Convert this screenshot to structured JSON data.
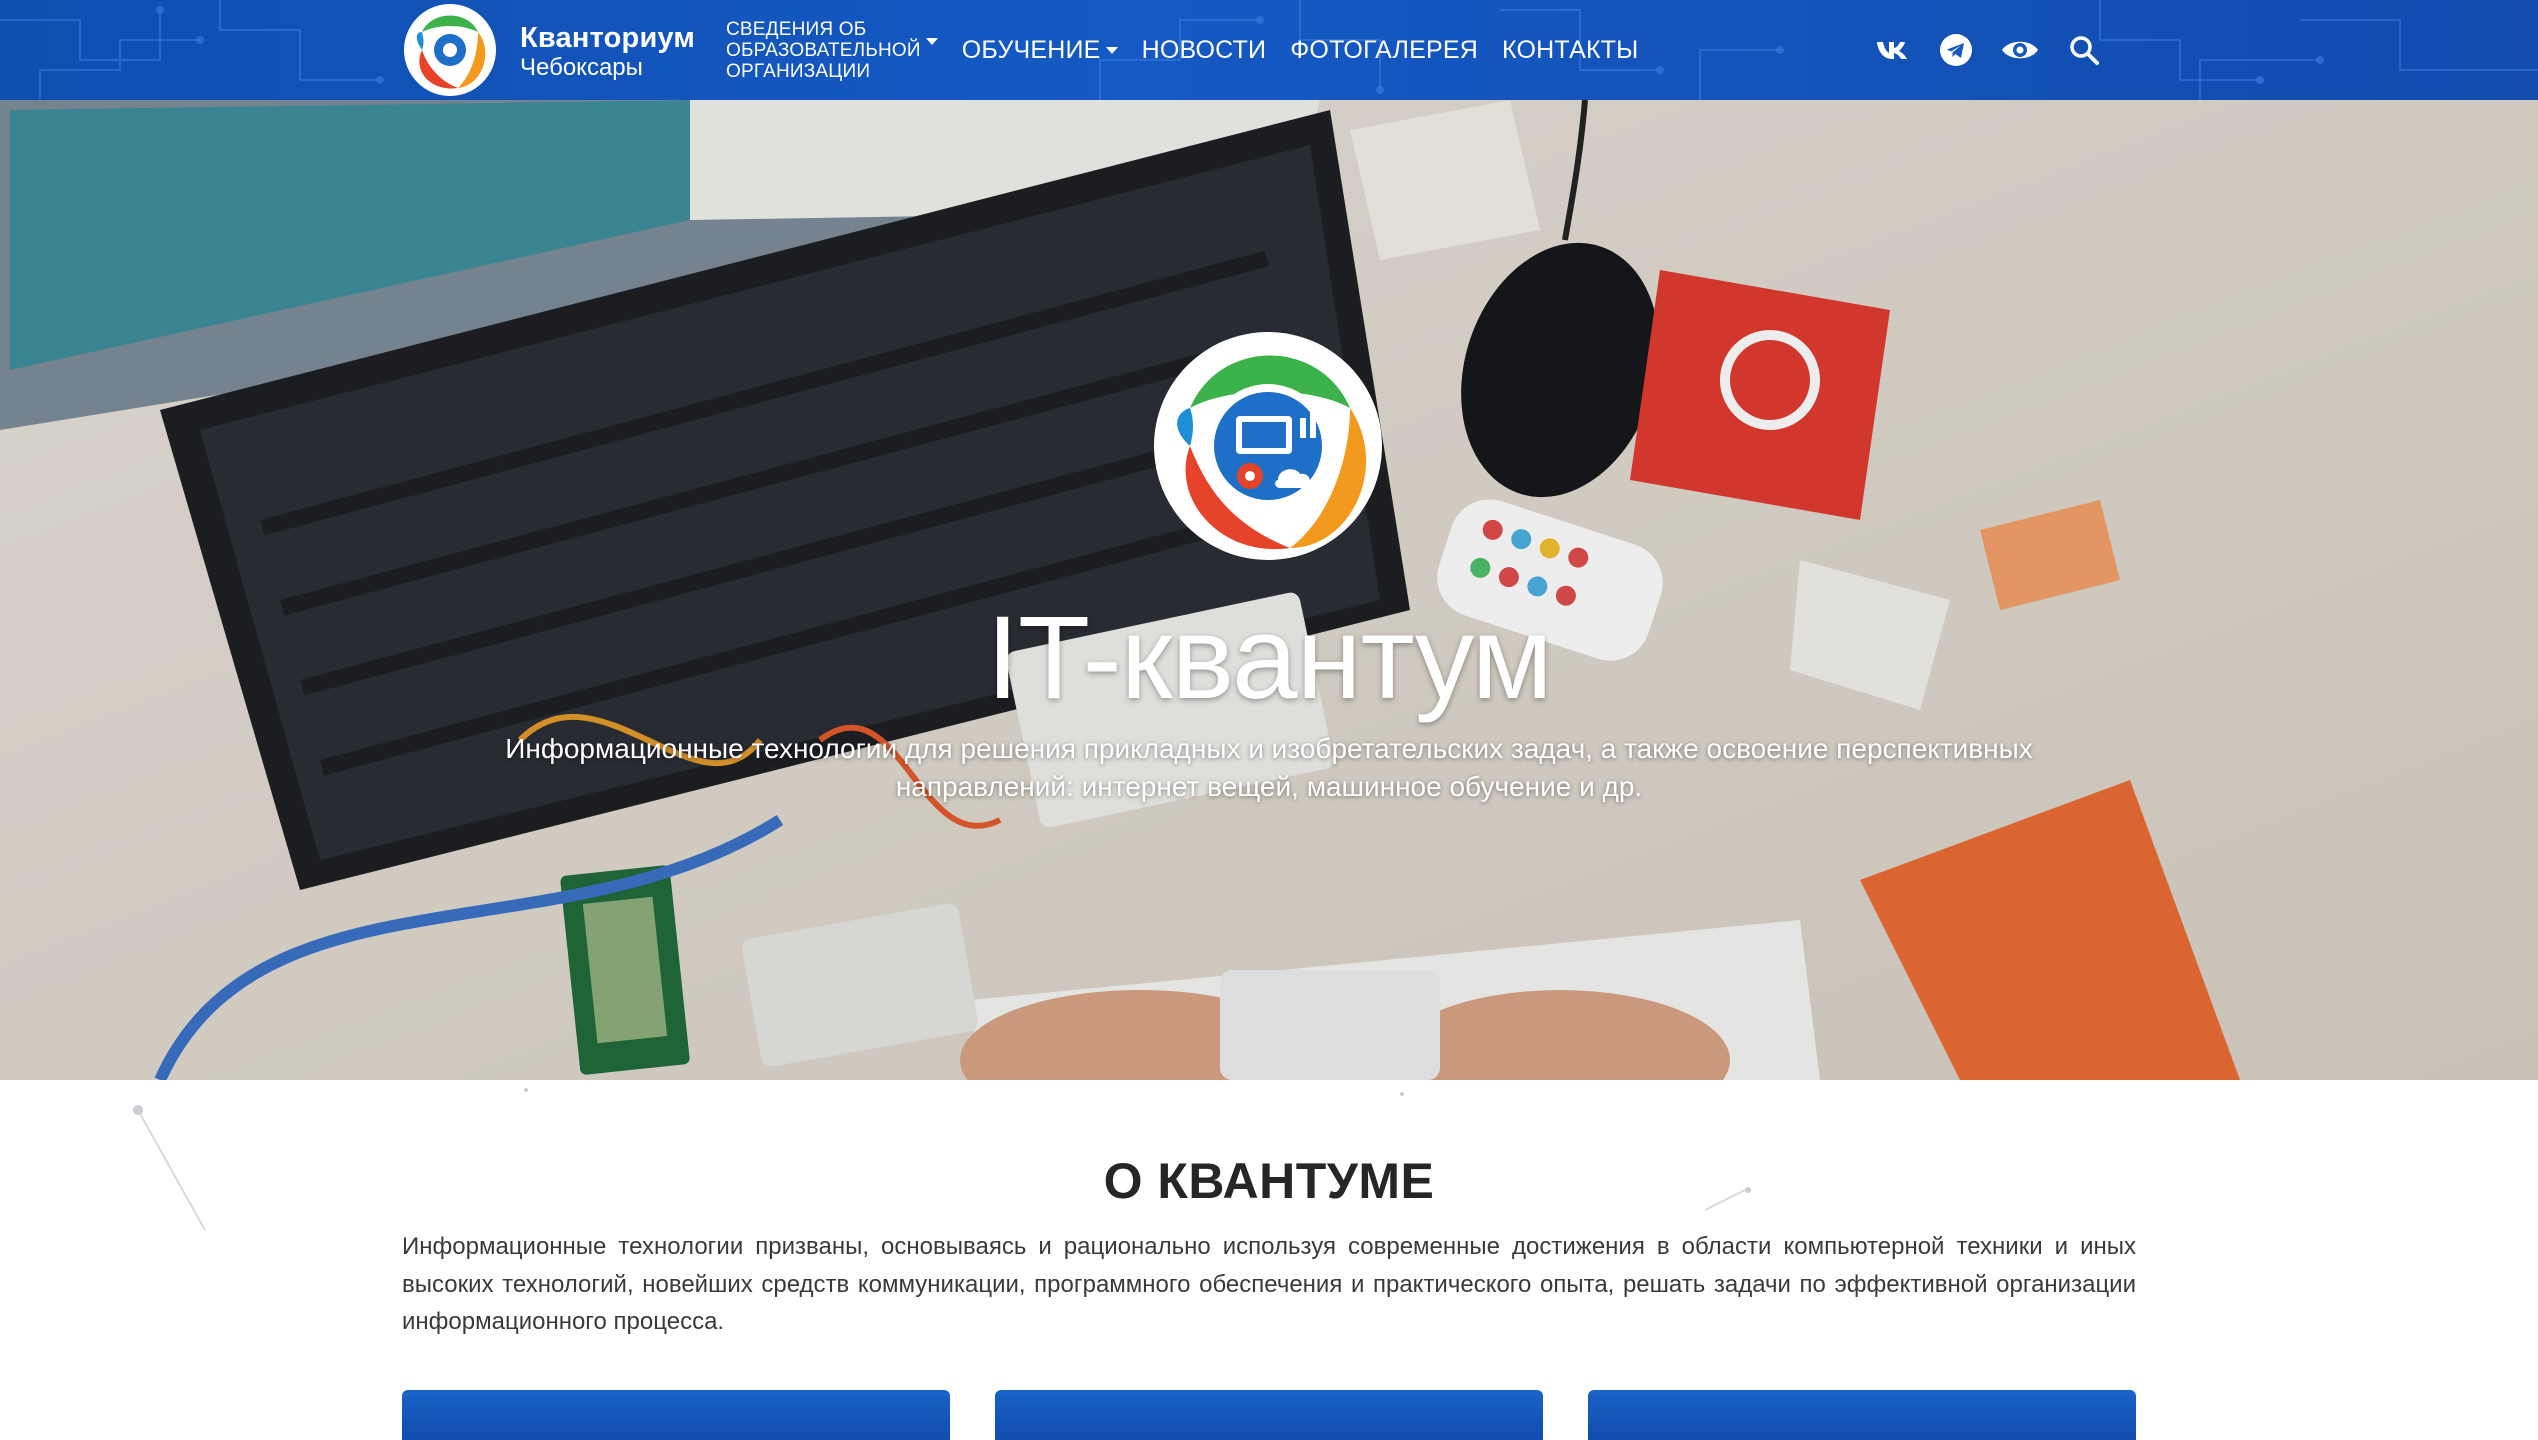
{
  "header": {
    "brand_name": "Кванториум",
    "brand_city": "Чебоксары",
    "nav": [
      {
        "lines": [
          "СВЕДЕНИЯ ОБ",
          "ОБРАЗОВАТЕЛЬНОЙ",
          "ОРГАНИЗАЦИИ"
        ],
        "dropdown": true
      },
      {
        "label": "ОБУЧЕНИЕ",
        "dropdown": true
      },
      {
        "label": "НОВОСТИ"
      },
      {
        "label": "ФОТОГАЛЕРЕЯ"
      },
      {
        "label": "КОНТАКТЫ"
      }
    ],
    "icons": [
      "vk-icon",
      "telegram-icon",
      "eye-icon",
      "search-icon"
    ]
  },
  "hero": {
    "title": "IT-квантум",
    "subtitle": "Информационные технологии для решения прикладных и изобретательских задач, а также освоение перспективных направлений: интернет вещей, машинное обучение и др."
  },
  "about": {
    "title": "О КВАНТУМЕ",
    "text": "Информационные технологии призваны, основываясь и рационально используя современные достижения в области компьютерной техники и иных высоких технологий, новейших средств коммуникации, программного обеспечения и практического опыта, решать задачи по эффективной организации информационного процесса."
  },
  "colors": {
    "header_blue": "#1559c4",
    "card_blue": "#1a63c8",
    "title_text": "#262626"
  }
}
